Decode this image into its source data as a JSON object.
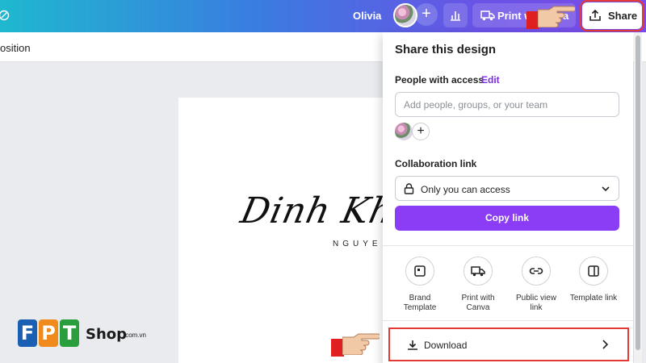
{
  "topbar": {
    "user_name": "Olivia",
    "print_label": "Print w",
    "print_label_tail": "a",
    "share_label": "Share"
  },
  "subbar": {
    "position_label": "osition"
  },
  "canvas": {
    "signature": "Dinh Khai",
    "signature_sub": "NGUYE"
  },
  "share_panel": {
    "title": "Share this design",
    "people_label": "People with access",
    "edit_label": "Edit",
    "add_placeholder": "Add people, groups, or your team",
    "collab_label": "Collaboration link",
    "access_value": "Only you can access",
    "copy_label": "Copy link",
    "options": [
      {
        "icon": "brand-template-icon",
        "label_1": "Brand",
        "label_2": "Template"
      },
      {
        "icon": "truck-icon",
        "label_1": "Print with",
        "label_2": "Canva"
      },
      {
        "icon": "link-icon",
        "label_1": "Public view",
        "label_2": "link"
      },
      {
        "icon": "template-link-icon",
        "label_1": "Template link",
        "label_2": ""
      }
    ],
    "download_label": "Download"
  },
  "watermark": {
    "letters": [
      "F",
      "P",
      "T"
    ],
    "shop": "Shop",
    "domain": ".com.vn"
  },
  "colors": {
    "accent": "#8b3cf5",
    "highlight": "#e53935",
    "edit": "#7d2ae8"
  }
}
